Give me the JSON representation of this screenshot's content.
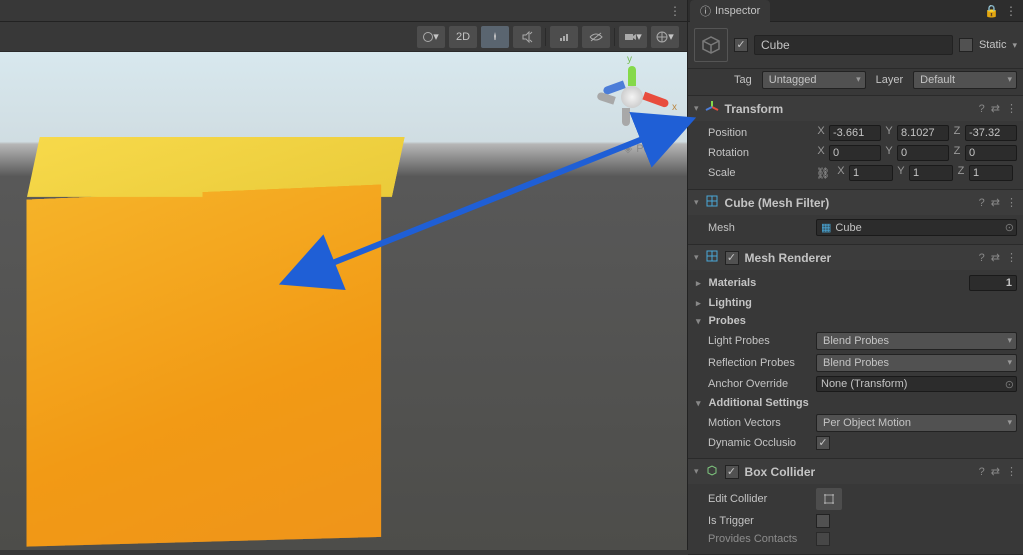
{
  "scene": {
    "toolbar": {
      "mode_2d": "2D",
      "persp_label": "Persp"
    }
  },
  "inspector": {
    "tab_label": "Inspector",
    "object_name": "Cube",
    "active": true,
    "static_label": "Static",
    "tag_label": "Tag",
    "tag_value": "Untagged",
    "layer_label": "Layer",
    "layer_value": "Default"
  },
  "transform": {
    "title": "Transform",
    "position": {
      "label": "Position",
      "x": "-3.661",
      "y": "8.1027",
      "z": "-37.32"
    },
    "rotation": {
      "label": "Rotation",
      "x": "0",
      "y": "0",
      "z": "0"
    },
    "scale": {
      "label": "Scale",
      "x": "1",
      "y": "1",
      "z": "1"
    }
  },
  "mesh_filter": {
    "title": "Cube (Mesh Filter)",
    "field_label": "Mesh",
    "field_value": "Cube"
  },
  "mesh_renderer": {
    "title": "Mesh Renderer",
    "materials": {
      "label": "Materials",
      "count": "1"
    },
    "lighting_label": "Lighting",
    "probes_label": "Probes",
    "light_probes": {
      "label": "Light Probes",
      "value": "Blend Probes"
    },
    "reflection_probes": {
      "label": "Reflection Probes",
      "value": "Blend Probes"
    },
    "anchor_override": {
      "label": "Anchor Override",
      "value": "None (Transform)"
    },
    "additional_label": "Additional Settings",
    "motion_vectors": {
      "label": "Motion Vectors",
      "value": "Per Object Motion"
    },
    "dynamic_occlusion": {
      "label": "Dynamic Occlusio",
      "value": true
    }
  },
  "box_collider": {
    "title": "Box Collider",
    "edit_label": "Edit Collider",
    "is_trigger_label": "Is Trigger",
    "provides_label": "Provides Contacts"
  },
  "axis": {
    "x": "X",
    "y": "Y",
    "z": "Z"
  }
}
